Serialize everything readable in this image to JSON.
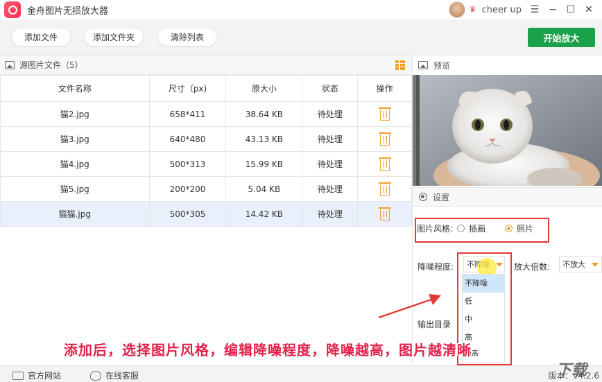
{
  "titlebar": {
    "title": "金舟图片无损放大器",
    "username": "cheer up",
    "window_controls": [
      "☰",
      "−",
      "☐",
      "✕"
    ]
  },
  "toolbar": {
    "add_file": "添加文件",
    "add_folder": "添加文件夹",
    "clear_list": "清除列表",
    "start": "开始放大"
  },
  "file_list": {
    "header_label": "源图片文件（5）",
    "columns": [
      "文件名称",
      "尺寸（px)",
      "原大小",
      "状态",
      "操作"
    ],
    "rows": [
      {
        "name": "猫2.jpg",
        "size": "658*411",
        "filesize": "38.64 KB",
        "status": "待处理"
      },
      {
        "name": "猫3.jpg",
        "size": "640*480",
        "filesize": "43.13 KB",
        "status": "待处理"
      },
      {
        "name": "猫4.jpg",
        "size": "500*313",
        "filesize": "15.99 KB",
        "status": "待处理"
      },
      {
        "name": "猫5.jpg",
        "size": "200*200",
        "filesize": "5.04 KB",
        "status": "待处理"
      },
      {
        "name": "猫猫.jpg",
        "size": "500*305",
        "filesize": "14.42 KB",
        "status": "待处理"
      }
    ]
  },
  "preview": {
    "label": "预览"
  },
  "settings": {
    "label": "设置",
    "style_label": "图片风格:",
    "style_options": [
      "插画",
      "照片"
    ],
    "noise_label": "降噪程度:",
    "noise_value": "不降噪",
    "noise_options": [
      "不降噪",
      "低",
      "中",
      "高",
      "最高"
    ],
    "zoom_label": "放大倍数:",
    "zoom_value": "不放大",
    "output_label": "输出目录"
  },
  "caption": "添加后，选择图片风格，编辑降噪程度，降噪越高，图片越清晰",
  "statusbar": {
    "website": "官方网站",
    "service": "在线客服",
    "version": "版本：v4.2.6"
  },
  "watermark": "下载",
  "colors": {
    "accent": "#f0a02c",
    "start_button": "#1aa149",
    "annotation": "#e53935"
  }
}
